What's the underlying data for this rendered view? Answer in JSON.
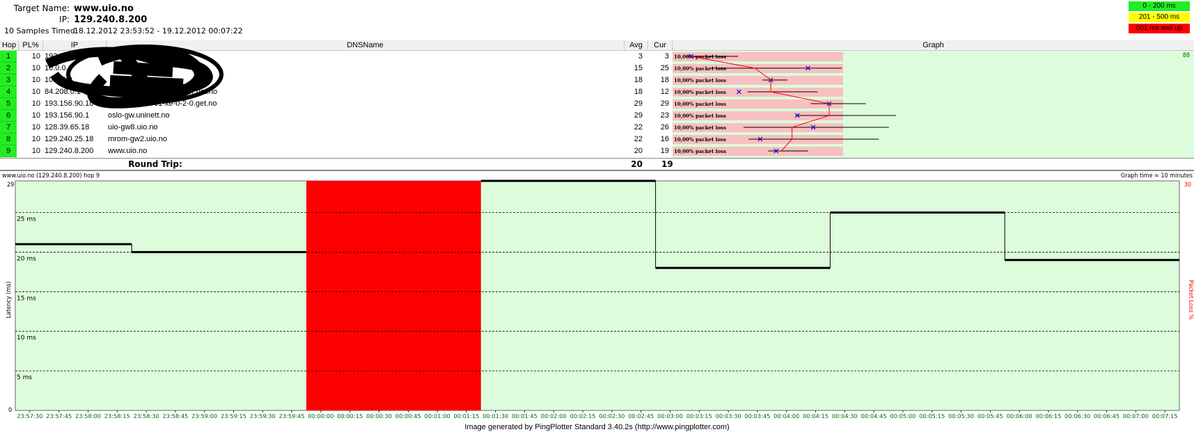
{
  "header": {
    "target_label": "Target Name:",
    "target_value": "www.uio.no",
    "ip_label": "IP:",
    "ip_value": "129.240.8.200",
    "samples_label": "10 Samples Timed:",
    "samples_value": "18.12.2012 23:53:52 - 19.12.2012 00:07:22"
  },
  "legend": [
    {
      "label": "0 - 200 ms",
      "color": "#22ee22"
    },
    {
      "label": "201 - 500 ms",
      "color": "#ffff00"
    },
    {
      "label": "501 ms and up",
      "color": "#ff0000"
    }
  ],
  "table": {
    "columns": [
      "Hop",
      "PL%",
      "IP",
      "DNSName",
      "Avg",
      "Cur",
      "Graph"
    ],
    "graph_max_label": "88",
    "rows": [
      {
        "hop": "1",
        "pl": "10",
        "ip": "192.168.1.1",
        "dns": "",
        "avg": "3",
        "cur": "3",
        "loss": "10,00% packet loss",
        "avg_ms": 3,
        "cur_ms": 3
      },
      {
        "hop": "2",
        "pl": "10",
        "ip": "10.0.0.1",
        "dns": "",
        "avg": "15",
        "cur": "25",
        "loss": "10,00% packet loss",
        "avg_ms": 15,
        "cur_ms": 25
      },
      {
        "hop": "3",
        "pl": "10",
        "ip": "10.0.0.2",
        "dns": "",
        "avg": "18",
        "cur": "18",
        "loss": "10,00% packet loss",
        "avg_ms": 18,
        "cur_ms": 18
      },
      {
        "hop": "4",
        "pl": "10",
        "ip": "84.208.0.1",
        "dns": "ti0019c360-xe-0.ti.telenor.net.no",
        "avg": "18",
        "cur": "12",
        "loss": "10,00% packet loss",
        "avg_ms": 18,
        "cur_ms": 12
      },
      {
        "hop": "5",
        "pl": "10",
        "ip": "193.156.90.18",
        "dns": "no-osl-323-rt-01-xe-0-2-0.get.no",
        "avg": "29",
        "cur": "29",
        "loss": "10,00% packet loss",
        "avg_ms": 29,
        "cur_ms": 29
      },
      {
        "hop": "6",
        "pl": "10",
        "ip": "193.156.90.1",
        "dns": "oslo-gw.uninett.no",
        "avg": "29",
        "cur": "23",
        "loss": "10,00% packet loss",
        "avg_ms": 29,
        "cur_ms": 23
      },
      {
        "hop": "7",
        "pl": "10",
        "ip": "128.39.65.18",
        "dns": "uio-gw8.uio.no",
        "avg": "22",
        "cur": "26",
        "loss": "10,00% packet loss",
        "avg_ms": 22,
        "cur_ms": 26
      },
      {
        "hop": "8",
        "pl": "10",
        "ip": "129.240.25.18",
        "dns": "mrom-gw2.uio.no",
        "avg": "22",
        "cur": "16",
        "loss": "10,00% packet loss",
        "avg_ms": 22,
        "cur_ms": 16
      },
      {
        "hop": "9",
        "pl": "10",
        "ip": "129.240.8.200",
        "dns": "www.uio.no",
        "avg": "20",
        "cur": "19",
        "loss": "10,00% packet loss",
        "avg_ms": 20,
        "cur_ms": 19
      }
    ],
    "round_trip": {
      "label": "Round Trip:",
      "avg": "20",
      "cur": "19"
    }
  },
  "latency_graph": {
    "title": "www.uio.no (129.240.8.200) hop 9",
    "graph_time": "Graph time = 10 minutes",
    "y_label": "Latency (ms)",
    "right_label": "Packet Loss %",
    "right_max": "30",
    "y_top": "29",
    "y_zero": "0",
    "y_ticks": [
      {
        "label": "25 ms",
        "value": 25
      },
      {
        "label": "20 ms",
        "value": 20
      },
      {
        "label": "15 ms",
        "value": 15
      },
      {
        "label": "10 ms",
        "value": 10
      },
      {
        "label": "5 ms",
        "value": 5
      }
    ],
    "x_ticks": [
      "23:57:30",
      "23:57:45",
      "23:58:00",
      "23:58:15",
      "23:58:30",
      "23:58:45",
      "23:59:00",
      "23:59:15",
      "23:59:30",
      "23:59:45",
      "00:00:00",
      "00:00:15",
      "00:00:30",
      "00:00:45",
      "00:01:00",
      "00:01:15",
      "00:01:30",
      "00:01:45",
      "00:02:00",
      "00:02:15",
      "00:02:30",
      "00:02:45",
      "00:03:00",
      "00:03:15",
      "00:03:30",
      "00:03:45",
      "00:04:00",
      "00:04:15",
      "00:04:30",
      "00:04:45",
      "00:05:00",
      "00:05:15",
      "00:05:30",
      "00:05:45",
      "00:06:00",
      "00:06:15",
      "00:06:30",
      "00:06:45",
      "00:07:00",
      "00:07:15"
    ],
    "samples": [
      {
        "start": 0,
        "end": 2,
        "ms": 21
      },
      {
        "start": 2,
        "end": 5,
        "ms": 20
      },
      {
        "start": 5,
        "end": 8,
        "loss": true
      },
      {
        "start": 8,
        "end": 11,
        "ms": 29
      },
      {
        "start": 11,
        "end": 14,
        "ms": 18
      },
      {
        "start": 14,
        "end": 17,
        "ms": 25
      },
      {
        "start": 17,
        "end": 20,
        "ms": 19
      }
    ],
    "colors": {
      "background": "#dcfcdc",
      "loss": "#ff0000",
      "line": "#000000",
      "tick_text": "#006600"
    }
  },
  "footer": "Image generated by PingPlotter Standard 3.40.2s (http://www.pingplotter.com)"
}
